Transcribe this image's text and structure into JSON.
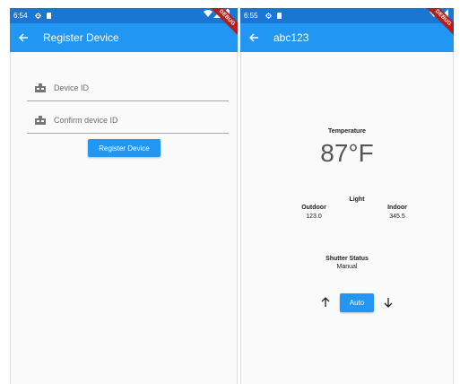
{
  "left": {
    "status_time": "6:54",
    "title": "Register Device",
    "device_id_placeholder": "Device ID",
    "confirm_placeholder": "Confirm device ID",
    "register_label": "Register Device"
  },
  "right": {
    "status_time": "6:55",
    "title": "abc123",
    "temperature_label": "Temperature",
    "temperature_value": "87°F",
    "light_label": "Light",
    "outdoor_label": "Outdoor",
    "outdoor_value": "123.0",
    "indoor_label": "Indoor",
    "indoor_value": "345.5",
    "shutter_label": "Shutter Status",
    "shutter_value": "Manual",
    "auto_label": "Auto"
  },
  "ribbon": "DEBUG",
  "colors": {
    "appbar": "#2196f3",
    "statusbar": "#1976d2",
    "background": "#fafafa",
    "ribbon": "#b71c1c"
  },
  "icons": [
    "back-arrow-icon",
    "settings-gear-icon",
    "sd-card-icon",
    "wifi-icon",
    "signal-icon",
    "battery-icon",
    "device-icon",
    "arrow-up-icon",
    "arrow-down-icon"
  ]
}
